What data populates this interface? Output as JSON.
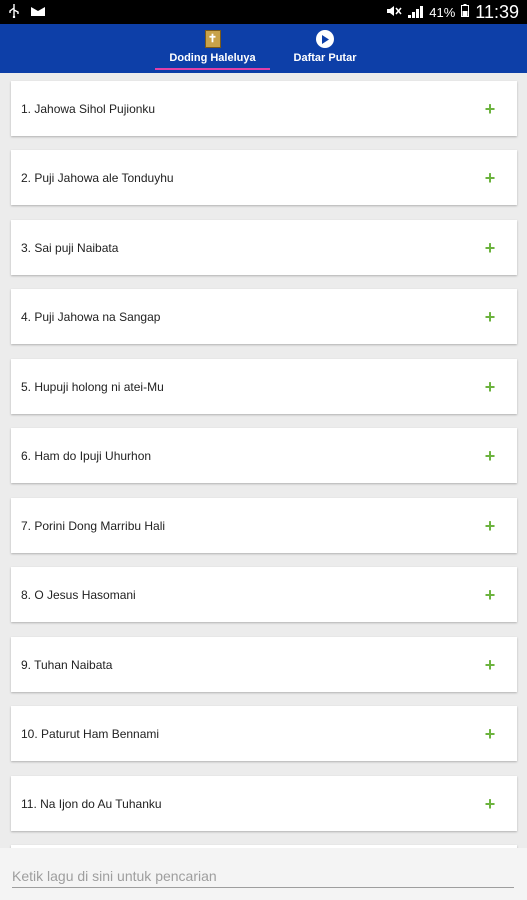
{
  "status_bar": {
    "battery_percent": "41%",
    "time": "11:39",
    "icons": [
      "usb-icon",
      "notification-icon",
      "mute-icon",
      "signal-icon",
      "battery-icon"
    ]
  },
  "tabs": [
    {
      "label": "Doding Haleluya",
      "icon": "book-icon",
      "active": true
    },
    {
      "label": "Daftar Putar",
      "icon": "play-circle-icon",
      "active": false
    }
  ],
  "songs": [
    {
      "title": "1. Jahowa Sihol Pujionku",
      "action_icon": "+"
    },
    {
      "title": "2. Puji Jahowa ale Tonduyhu",
      "action_icon": "+"
    },
    {
      "title": "3. Sai puji Naibata",
      "action_icon": "+"
    },
    {
      "title": "4. Puji Jahowa na Sangap",
      "action_icon": "+"
    },
    {
      "title": "5. Hupuji holong ni atei-Mu",
      "action_icon": "+"
    },
    {
      "title": "6. Ham do Ipuji Uhurhon",
      "action_icon": "+"
    },
    {
      "title": "7. Porini Dong Marribu Hali",
      "action_icon": "+"
    },
    {
      "title": "8. O Jesus Hasomani",
      "action_icon": "+"
    },
    {
      "title": "9. Tuhan Naibata",
      "action_icon": "+"
    },
    {
      "title": "10. Paturut Ham Bennami",
      "action_icon": "+"
    },
    {
      "title": "11. Na Ijon do Au Tuhanku",
      "action_icon": "+"
    }
  ],
  "search": {
    "placeholder": "Ketik lagu di sini untuk pencarian",
    "value": ""
  },
  "colors": {
    "app_bar": "#0d3fa8",
    "tab_indicator": "#e040a8",
    "add_icon": "#6cb33e",
    "background": "#ececec"
  }
}
